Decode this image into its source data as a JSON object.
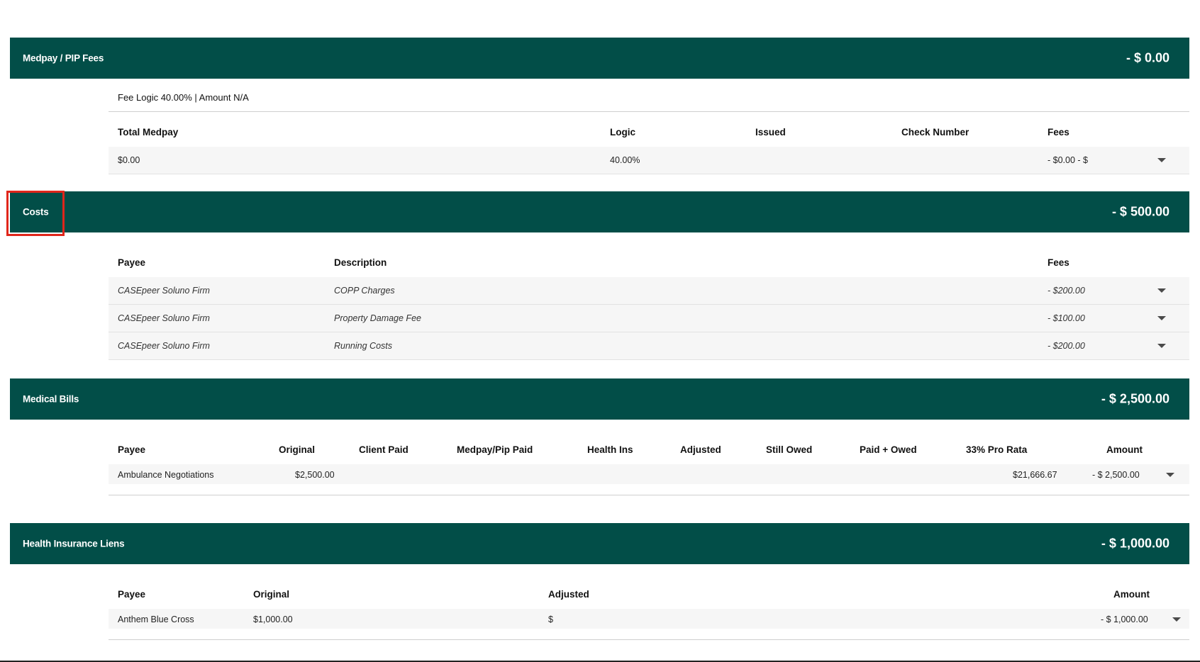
{
  "medpay": {
    "title": "Medpay / PIP Fees",
    "total": "- $ 0.00",
    "fee_logic": "Fee Logic 40.00% | Amount N/A",
    "headers": {
      "total_medpay": "Total Medpay",
      "logic": "Logic",
      "issued": "Issued",
      "check_number": "Check Number",
      "fees": "Fees"
    },
    "rows": [
      {
        "total_medpay": "$0.00",
        "logic": "40.00%",
        "issued": "",
        "check_number": "",
        "fees": "- $0.00 - $"
      }
    ]
  },
  "costs": {
    "title": "Costs",
    "total": "- $ 500.00",
    "headers": {
      "payee": "Payee",
      "description": "Description",
      "fees": "Fees"
    },
    "rows": [
      {
        "payee": "CASEpeer Soluno Firm",
        "description": "COPP Charges",
        "fees": "- $200.00"
      },
      {
        "payee": "CASEpeer Soluno Firm",
        "description": "Property Damage Fee",
        "fees": "- $100.00"
      },
      {
        "payee": "CASEpeer Soluno Firm",
        "description": "Running Costs",
        "fees": "- $200.00"
      }
    ]
  },
  "medical_bills": {
    "title": "Medical Bills",
    "total": "- $ 2,500.00",
    "headers": {
      "payee": "Payee",
      "original": "Original",
      "client_paid": "Client Paid",
      "medpay_pip_paid": "Medpay/Pip Paid",
      "health_ins": "Health Ins",
      "adjusted": "Adjusted",
      "still_owed": "Still Owed",
      "paid_owed": "Paid + Owed",
      "pro_rata": "33% Pro Rata",
      "amount": "Amount"
    },
    "rows": [
      {
        "payee": "Ambulance Negotiations",
        "original": "$2,500.00",
        "pro_rata": "$21,666.67",
        "amount": "- $ 2,500.00"
      }
    ]
  },
  "health_liens": {
    "title": "Health Insurance Liens",
    "total": "- $ 1,000.00",
    "headers": {
      "payee": "Payee",
      "original": "Original",
      "adjusted": "Adjusted",
      "amount": "Amount"
    },
    "rows": [
      {
        "payee": "Anthem Blue Cross",
        "original": "$1,000.00",
        "adjusted": "$",
        "amount": "- $ 1,000.00"
      }
    ]
  }
}
